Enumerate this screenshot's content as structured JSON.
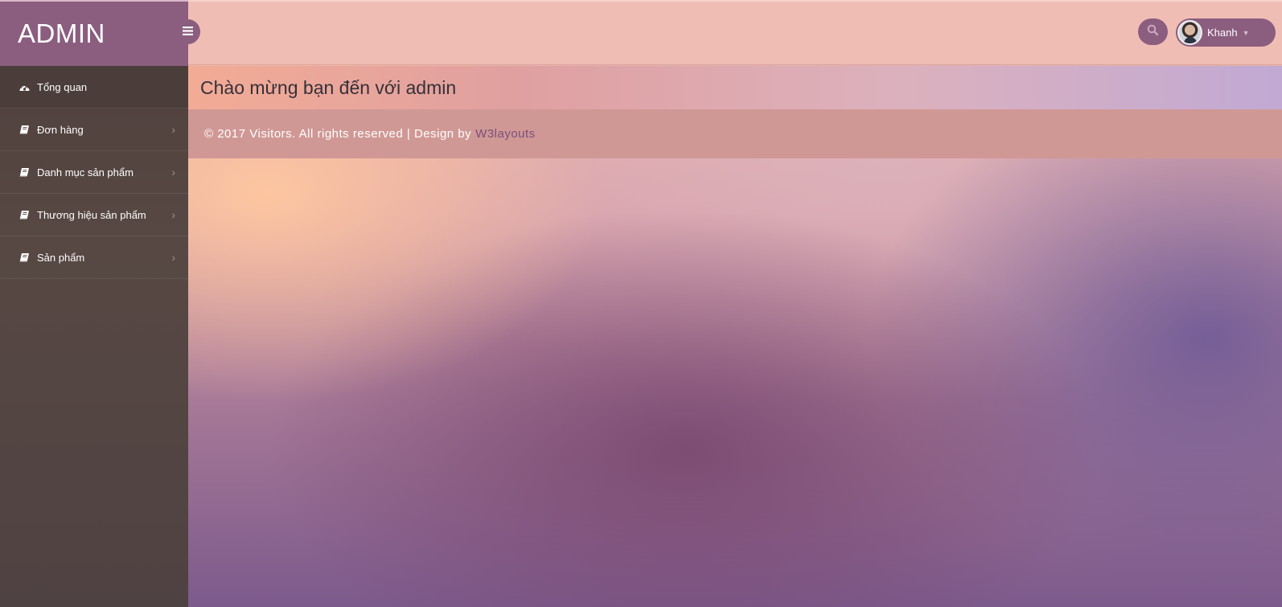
{
  "brand": {
    "title": "ADMIN"
  },
  "sidebar": {
    "items": [
      {
        "label": "Tổng quan",
        "icon": "dashboard-icon",
        "active": true
      },
      {
        "label": "Đơn hàng",
        "icon": "book-icon",
        "has_submenu": true
      },
      {
        "label": "Danh mục sản phẩm",
        "icon": "book-icon",
        "has_submenu": true
      },
      {
        "label": "Thương hiệu sản phẩm",
        "icon": "book-icon",
        "has_submenu": true
      },
      {
        "label": "Sản phẩm",
        "icon": "book-icon",
        "has_submenu": true
      }
    ]
  },
  "header": {
    "user_name": "Khanh",
    "search_icon": "search-icon",
    "toggle_icon": "hamburger-icon"
  },
  "main": {
    "welcome": "Chào mừng bạn đến với admin",
    "footer_text": "© 2017 Visitors. All rights reserved | Design by",
    "footer_link": "W3layouts"
  },
  "colors": {
    "accent": "#8b5d7f",
    "header_bg": "#f0bdb5",
    "sidebar_bg": "#574843",
    "footer_bg": "#d09895"
  }
}
